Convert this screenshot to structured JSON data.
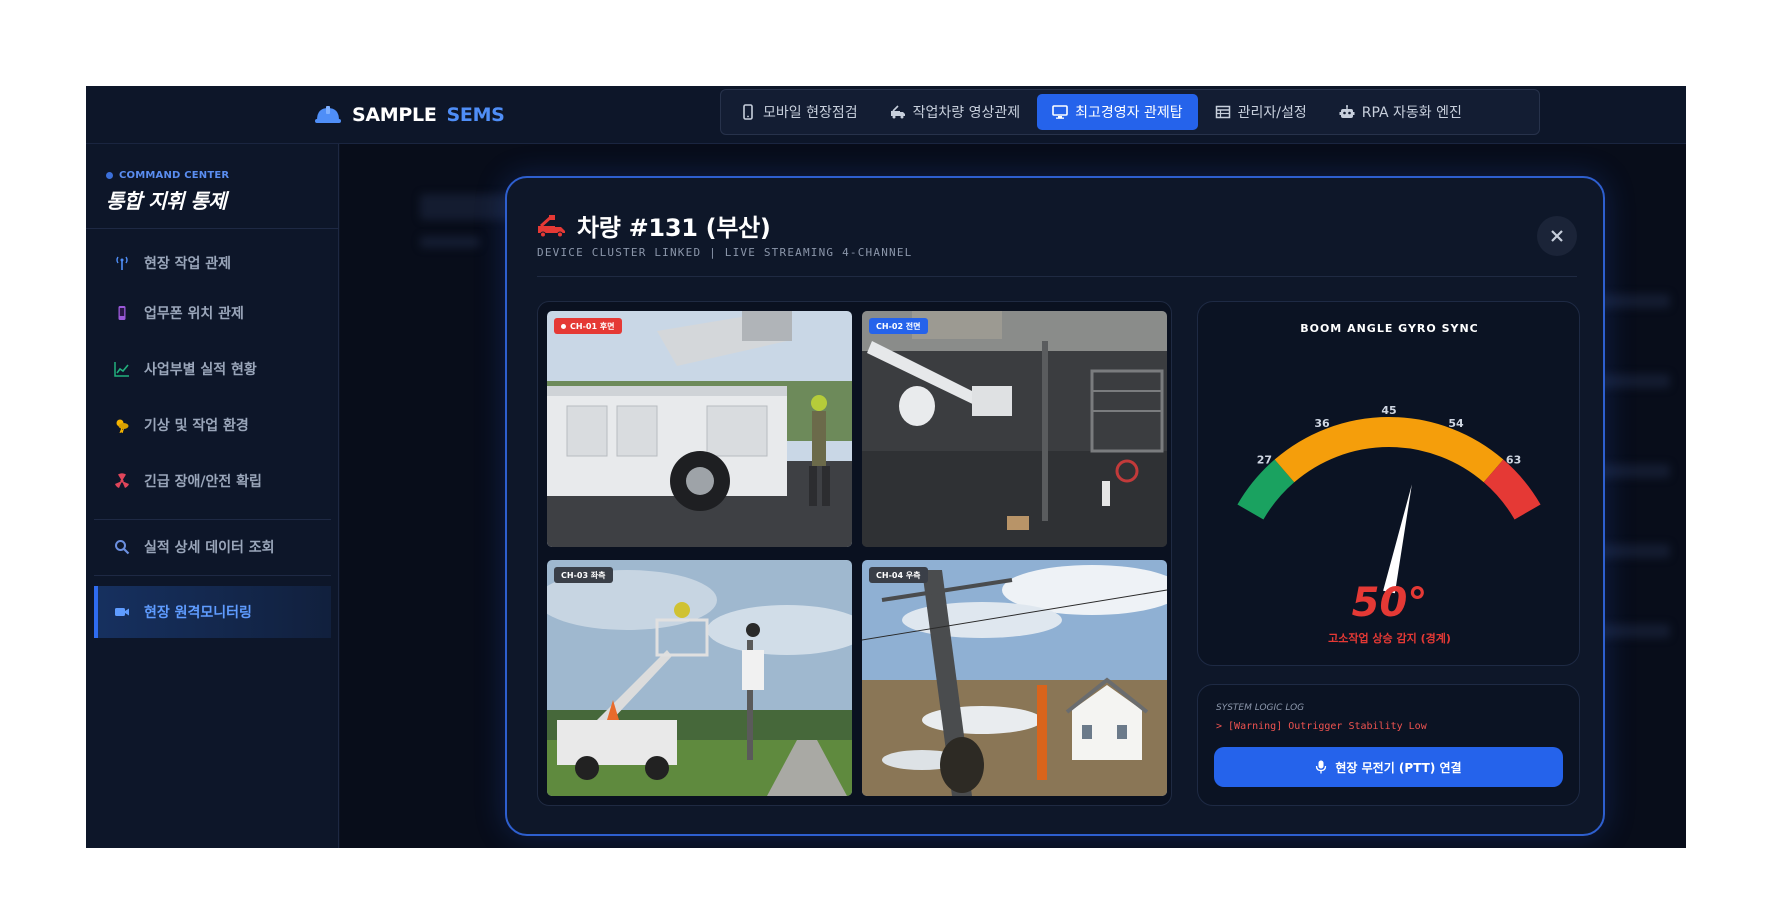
{
  "brand": {
    "part1": "SAMPLE",
    "part2": "SEMS"
  },
  "nav": {
    "tabs": [
      {
        "label": "모바일 현장점검",
        "icon": "mobile-icon"
      },
      {
        "label": "작업차량 영상관제",
        "icon": "truck-icon"
      },
      {
        "label": "최고경영자 관제탑",
        "icon": "monitor-icon",
        "active": true
      },
      {
        "label": "관리자/설정",
        "icon": "table-icon"
      },
      {
        "label": "RPA 자동화 엔진",
        "icon": "robot-icon"
      }
    ]
  },
  "sidebar": {
    "tag": "COMMAND CENTER",
    "title": "통합 지휘 통제",
    "items": [
      {
        "label": "현장 작업 관제",
        "icon": "antenna-icon"
      },
      {
        "label": "업무폰 위치 관제",
        "icon": "phone-icon"
      },
      {
        "label": "사업부별 실적 현황",
        "icon": "chart-icon"
      },
      {
        "label": "기상 및 작업 환경",
        "icon": "weather-icon"
      },
      {
        "label": "긴급 장애/안전 확립",
        "icon": "hazard-icon"
      },
      {
        "label": "실적 상세 데이터 조회",
        "icon": "search-icon"
      },
      {
        "label": "현장 원격모니터링",
        "icon": "camera-icon",
        "active": true
      }
    ]
  },
  "modal": {
    "title": "차량 #131 (부산)",
    "subtitle": "DEVICE CLUSTER LINKED | LIVE STREAMING 4-CHANNEL",
    "cameras": [
      {
        "label": "CH-01 후면",
        "recording": true,
        "tag_color": "#e53935"
      },
      {
        "label": "CH-02 전면",
        "recording": false,
        "tag_color": "#2563eb"
      },
      {
        "label": "CH-03 좌측",
        "recording": false,
        "tag_color": "#3a3f48"
      },
      {
        "label": "CH-04 우측",
        "recording": false,
        "tag_color": "#3a3f48"
      }
    ],
    "gyro": {
      "title": "BOOM ANGLE GYRO SYNC",
      "ticks": [
        "27",
        "36",
        "45",
        "54",
        "63"
      ],
      "min": 20,
      "max": 70,
      "value": 50,
      "value_label": "50°",
      "status": "고소작업 상승 감지 (경계)",
      "colors": {
        "safe": "#1aa260",
        "caution": "#f59e0b",
        "danger": "#e53935"
      }
    },
    "log": {
      "title": "SYSTEM LOGIC LOG",
      "line": "> [Warning] Outrigger Stability Low"
    },
    "ptt_label": "현장 무전기 (PTT) 연결"
  }
}
